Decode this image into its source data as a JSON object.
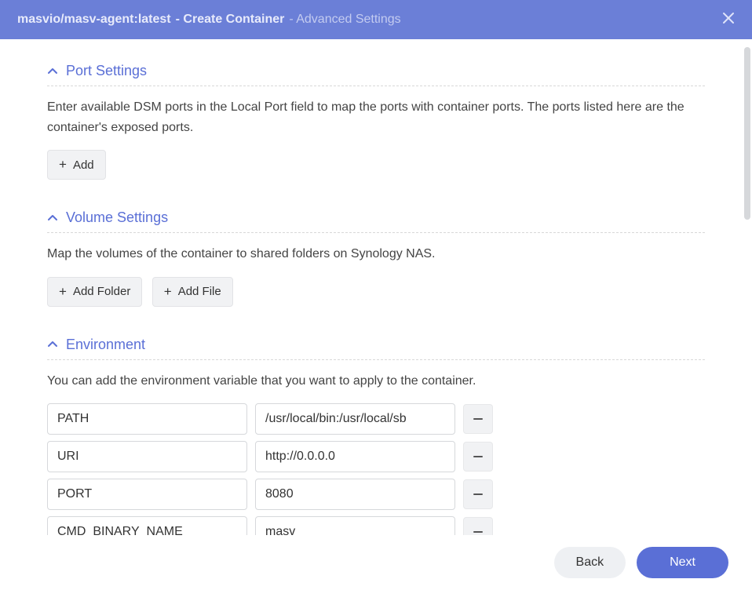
{
  "header": {
    "image": "masvio/masv-agent:latest",
    "title": "- Create Container",
    "subtitle": "- Advanced Settings"
  },
  "sections": {
    "port": {
      "title": "Port Settings",
      "desc": "Enter available DSM ports in the Local Port field to map the ports with container ports. The ports listed here are the container's exposed ports.",
      "add": "Add"
    },
    "volume": {
      "title": "Volume Settings",
      "desc": "Map the volumes of the container to shared folders on Synology NAS.",
      "addFolder": "Add Folder",
      "addFile": "Add File"
    },
    "env": {
      "title": "Environment",
      "desc": "You can add the environment variable that you want to apply to the container.",
      "rows": [
        {
          "key": "PATH",
          "val": "/usr/local/bin:/usr/local/sb"
        },
        {
          "key": "URI",
          "val": "http://0.0.0.0"
        },
        {
          "key": "PORT",
          "val": "8080"
        },
        {
          "key": "CMD_BINARY_NAME",
          "val": "masv"
        }
      ]
    }
  },
  "footer": {
    "back": "Back",
    "next": "Next"
  }
}
